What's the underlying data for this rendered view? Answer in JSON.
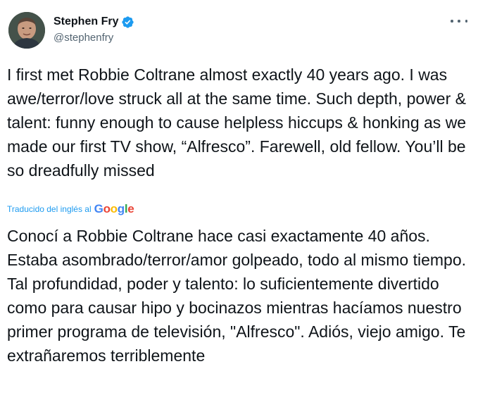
{
  "author": {
    "display_name": "Stephen Fry",
    "handle": "@stephenfry",
    "verified": true
  },
  "icons": {
    "avatar": "profile-photo",
    "verified": "verified-badge-icon",
    "more": "more-options-icon"
  },
  "colors": {
    "verified_blue": "#1d9bf0",
    "text": "#0f1419",
    "muted": "#536471",
    "link": "#1d9bf0"
  },
  "tweet": {
    "original_text": "I first met Robbie Coltrane almost exactly 40 years ago. I was awe/terror/love struck all at the same time. Such depth, power & talent: funny enough to cause helpless hiccups & honking as we made our first TV show, “Alfresco”. Farewell, old fellow. You’ll be so dreadfully missed",
    "translated_by_label": "Traducido del inglés al",
    "translation_provider": "Google",
    "translated_text": "Conocí a Robbie Coltrane hace casi exactamente 40 años. Estaba asombrado/terror/amor golpeado, todo al mismo tiempo. Tal profundidad, poder y talento: lo suficientemente divertido como para causar hipo y bocinazos mientras hacíamos nuestro primer programa de televisión, \"Alfresco\". Adiós, viejo amigo. Te extrañaremos terriblemente"
  }
}
